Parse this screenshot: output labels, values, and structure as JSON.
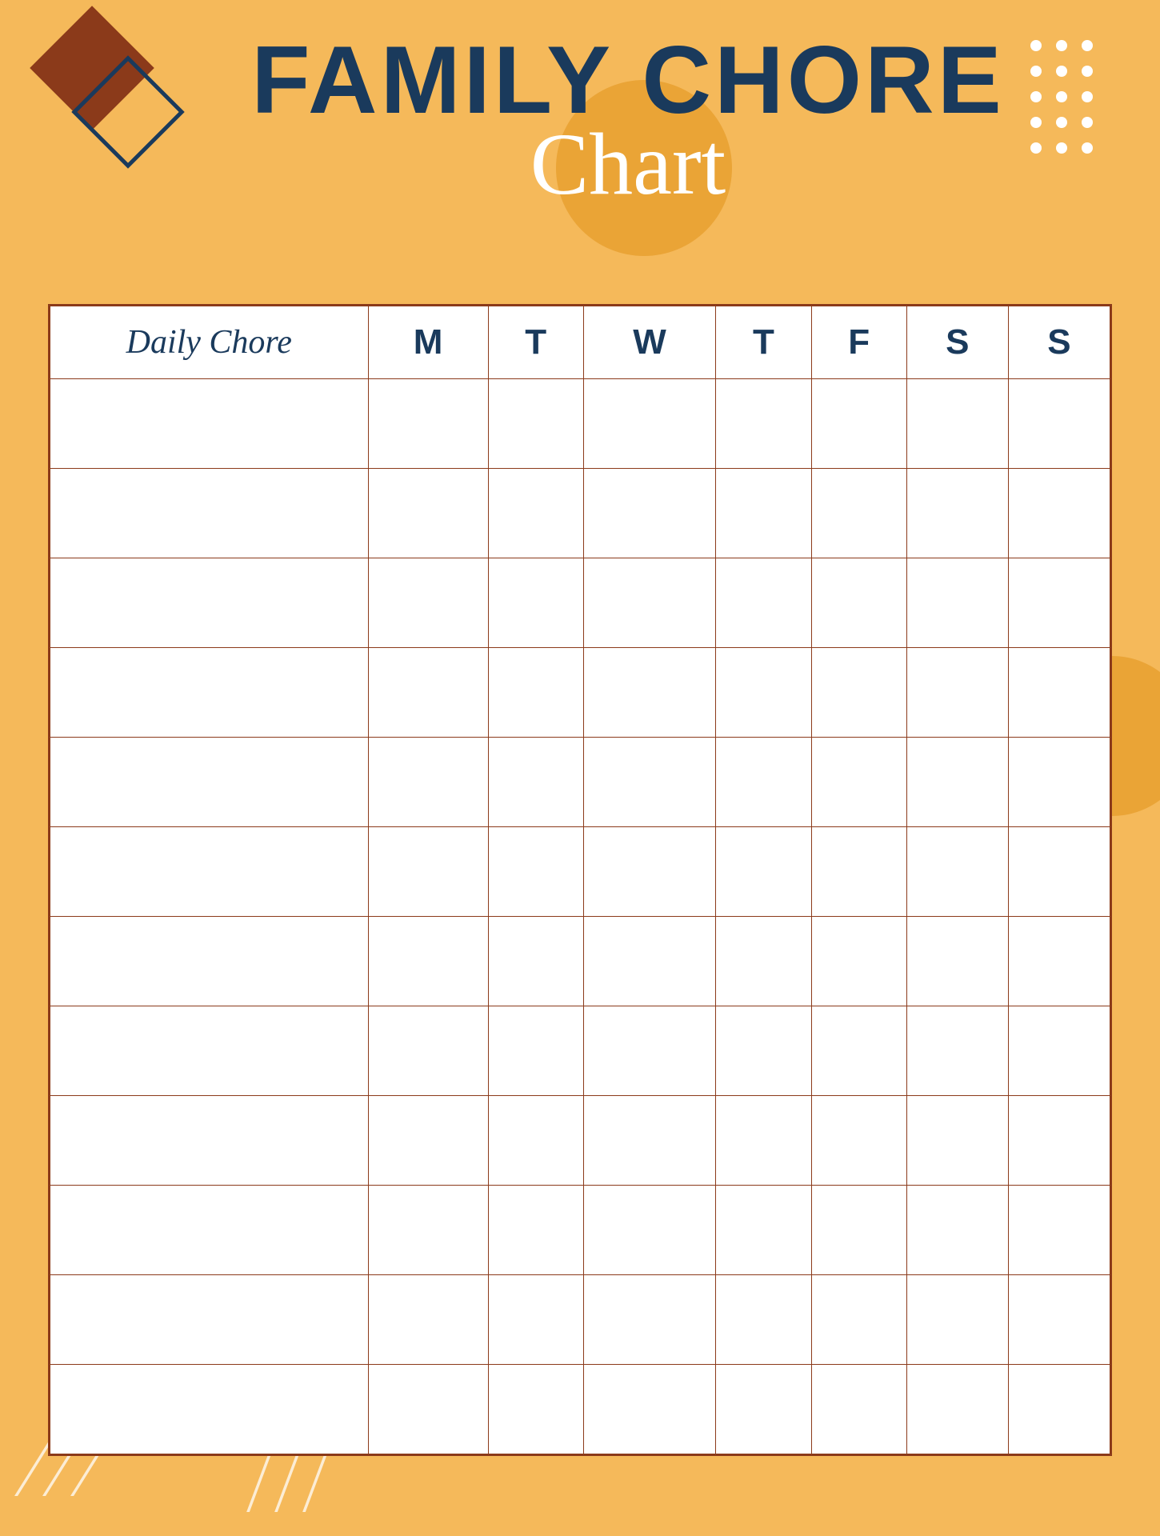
{
  "page": {
    "background_color": "#F5B95A",
    "title_line1": "FAMILY CHORE",
    "title_line2": "Chart",
    "table": {
      "header": {
        "chore_column": "Daily Chore",
        "days": [
          "M",
          "T",
          "W",
          "T",
          "F",
          "S",
          "S"
        ]
      },
      "rows": 12
    }
  },
  "decorations": {
    "diamond_brown_color": "#8B3A1A",
    "diamond_outline_color": "#1A3A5C",
    "circle_color": "#E8A030",
    "dot_color": "#FFFFFF",
    "line_color": "#FFFFFF"
  }
}
